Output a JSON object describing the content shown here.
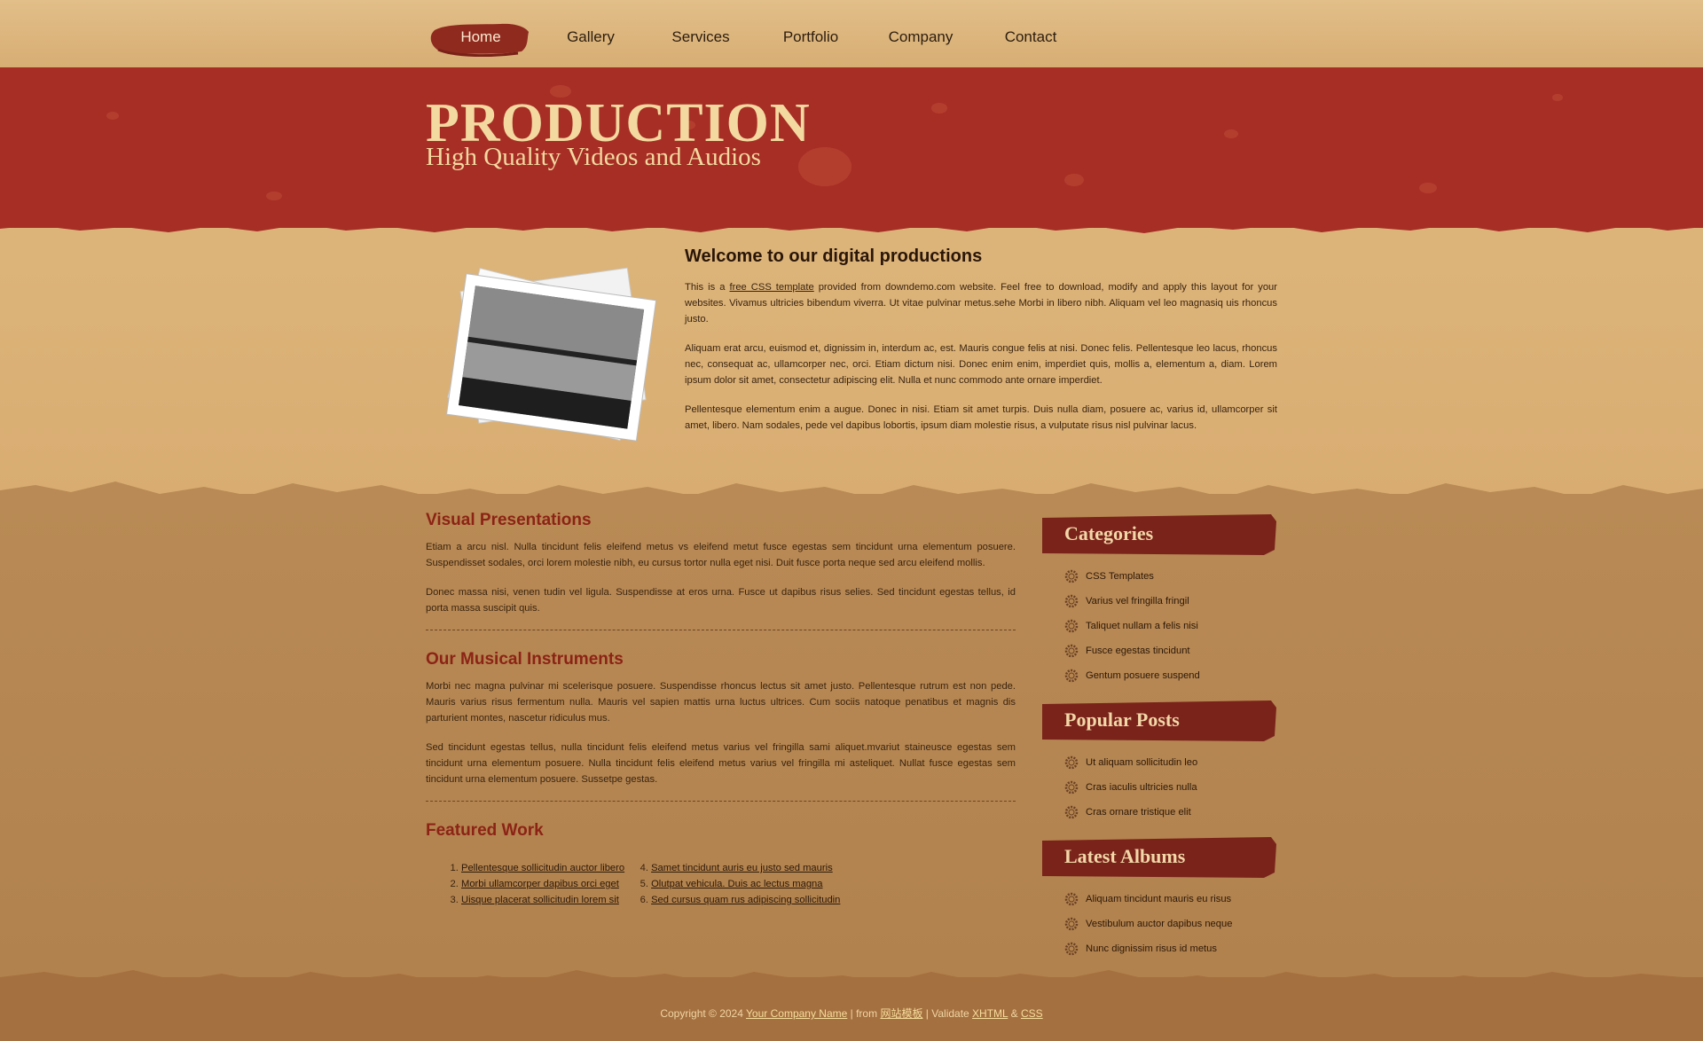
{
  "nav": {
    "items": [
      {
        "label": "Home",
        "active": true
      },
      {
        "label": "Gallery",
        "active": false
      },
      {
        "label": "Services",
        "active": false
      },
      {
        "label": "Portfolio",
        "active": false
      },
      {
        "label": "Company",
        "active": false
      },
      {
        "label": "Contact",
        "active": false
      }
    ]
  },
  "header": {
    "title": "PRODUCTION",
    "subtitle": "High Quality Videos and Audios"
  },
  "welcome": {
    "heading": "Welcome to our digital productions",
    "p1_pre": "This is a ",
    "p1_link": "free CSS template",
    "p1_post": " provided from downdemo.com website. Feel free to download, modify and apply this layout for your websites. Vivamus ultricies bibendum viverra. Ut vitae pulvinar metus.sehe Morbi in libero nibh. Aliquam vel leo magnasiq uis rhoncus justo.",
    "p2": "Aliquam erat arcu, euismod et, dignissim in, interdum ac, est. Mauris congue felis at nisi. Donec felis. Pellentesque leo lacus, rhoncus nec, consequat ac, ullamcorper nec, orci. Etiam dictum nisi. Donec enim enim, imperdiet quis, mollis a, elementum a, diam. Lorem ipsum dolor sit amet, consectetur adipiscing elit. Nulla et nunc commodo ante ornare imperdiet.",
    "p3": "Pellentesque elementum enim a augue. Donec in nisi. Etiam sit amet turpis. Duis nulla diam, posuere ac, varius id, ullamcorper sit amet, libero. Nam sodales, pede vel dapibus lobortis, ipsum diam molestie risus, a vulputate risus nisl pulvinar lacus."
  },
  "main": {
    "visual": {
      "heading": "Visual Presentations",
      "p1": "Etiam a arcu nisl. Nulla tincidunt felis eleifend metus vs eleifend metut fusce egestas sem tincidunt urna elementum posuere. Suspendisset sodales, orci lorem molestie nibh, eu cursus tortor nulla eget nisi. Duit fusce porta neque sed arcu eleifend mollis.",
      "p2": "Donec massa nisi, venen tudin vel ligula. Suspendisse at eros urna. Fusce ut dapibus risus selies. Sed tincidunt egestas tellus, id porta massa suscipit quis."
    },
    "music": {
      "heading": "Our Musical Instruments",
      "p1": "Morbi nec magna pulvinar mi scelerisque posuere. Suspendisse rhoncus lectus sit amet justo. Pellentesque rutrum est non pede. Mauris varius risus fermentum nulla. Mauris vel sapien mattis urna luctus ultrices. Cum sociis natoque penatibus et magnis dis parturient montes, nascetur ridiculus mus.",
      "p2": "Sed tincidunt egestas tellus, nulla tincidunt felis eleifend metus varius vel fringilla sami aliquet.mvariut staineusce egestas sem tincidunt urna elementum posuere. Nulla tincidunt felis eleifend metus varius vel fringilla mi asteliquet. Nullat fusce egestas sem tincidunt urna elementum posuere. Sussetpe gestas."
    },
    "featured": {
      "heading": "Featured Work",
      "col1": [
        "Pellentesque sollicitudin auctor libero",
        "Morbi ullamcorper dapibus orci eget",
        "Uisque placerat sollicitudin lorem sit"
      ],
      "col2": [
        "Samet tincidunt auris eu justo sed mauris",
        "Olutpat vehicula. Duis ac lectus magna",
        "Sed cursus quam rus adipiscing sollicitudin"
      ]
    }
  },
  "sidebar": {
    "categories": {
      "title": "Categories",
      "items": [
        "CSS Templates",
        "Varius vel fringilla fringil",
        "Taliquet nullam a felis nisi",
        "Fusce egestas tincidunt",
        "Gentum posuere suspend"
      ]
    },
    "popular": {
      "title": "Popular Posts",
      "items": [
        "Ut aliquam sollicitudin leo",
        "Cras iaculis ultricies nulla",
        "Cras ornare tristique elit"
      ]
    },
    "albums": {
      "title": "Latest Albums",
      "items": [
        "Aliquam tincidunt mauris eu risus",
        "Vestibulum auctor dapibus neque",
        "Nunc dignissim risus id metus"
      ]
    }
  },
  "footer": {
    "copyright": "Copyright © 2024 ",
    "company_link": "Your Company Name",
    "from_text": " | from ",
    "from_link": "网站模板",
    "validate_text": " | Validate ",
    "xhtml_link": "XHTML",
    "amp": " & ",
    "css_link": "CSS"
  },
  "colors": {
    "banner_red": "#a72e25",
    "title_cream": "#f3d9a0",
    "heading_red": "#8c2315",
    "sidebar_head": "#7a231a"
  },
  "icons": {
    "nav_active": "brush-stroke",
    "list_bullet": "gear-icon"
  }
}
